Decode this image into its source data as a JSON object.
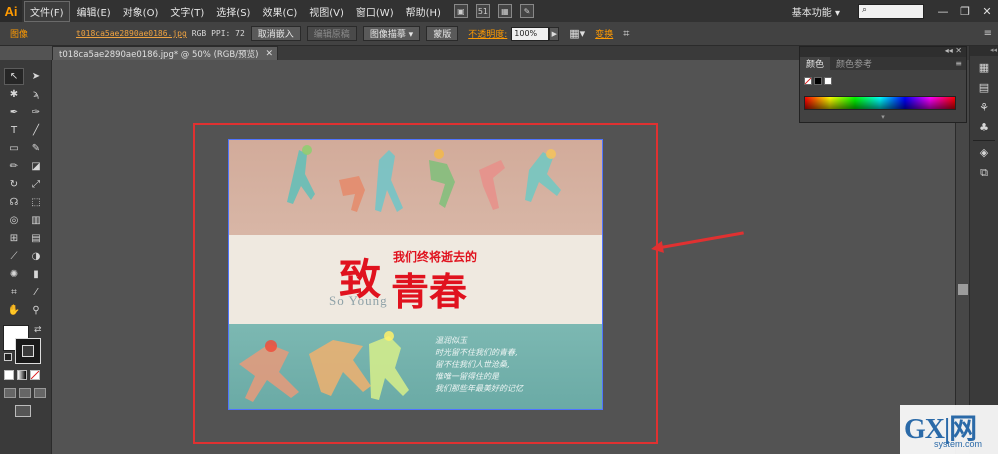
{
  "app": {
    "logo": "Ai"
  },
  "menubar": {
    "items": [
      "文件(F)",
      "编辑(E)",
      "对象(O)",
      "文字(T)",
      "选择(S)",
      "效果(C)",
      "视图(V)",
      "窗口(W)",
      "帮助(H)"
    ],
    "arrange_label": "51",
    "workspace": "基本功能 ▾",
    "search_placeholder": "",
    "window_buttons": [
      "—",
      "❐",
      "✕"
    ]
  },
  "controlbar": {
    "object_type": "图像",
    "file_link": "t018ca5ae2890ae0186.jpg",
    "color_info": "RGB  PPI: 72",
    "buttons": [
      "取消嵌入",
      "编辑原稿",
      "图像描摹 ▾",
      "蒙版"
    ],
    "opacity_label": "不透明度:",
    "opacity_value": "100%",
    "transform_label": "变换"
  },
  "document": {
    "tab_title": "t018ca5ae2890ae0186.jpg* @ 50% (RGB/预览)",
    "close": "✕"
  },
  "artwork": {
    "small_title": "我们终将逝去的",
    "big_char_1": "致",
    "big_chars_2": "青春",
    "english": "So Young",
    "poem": [
      "温润似玉",
      "时光留不住我们的青春,",
      "留不住我们人世沧桑,",
      "惟唯一留得住的是",
      "我们那些年最美好的记忆"
    ]
  },
  "color_panel": {
    "tabs": [
      "颜色",
      "颜色参考"
    ],
    "colors": {
      "fill": "#ffffff",
      "stroke": "#1a1a1a"
    }
  },
  "watermark": {
    "main": "GX|网",
    "sub": "system.com"
  },
  "colors": {
    "accent": "#ff9a00",
    "highlight_red": "#e03131",
    "selection_blue": "#4f74ff"
  }
}
